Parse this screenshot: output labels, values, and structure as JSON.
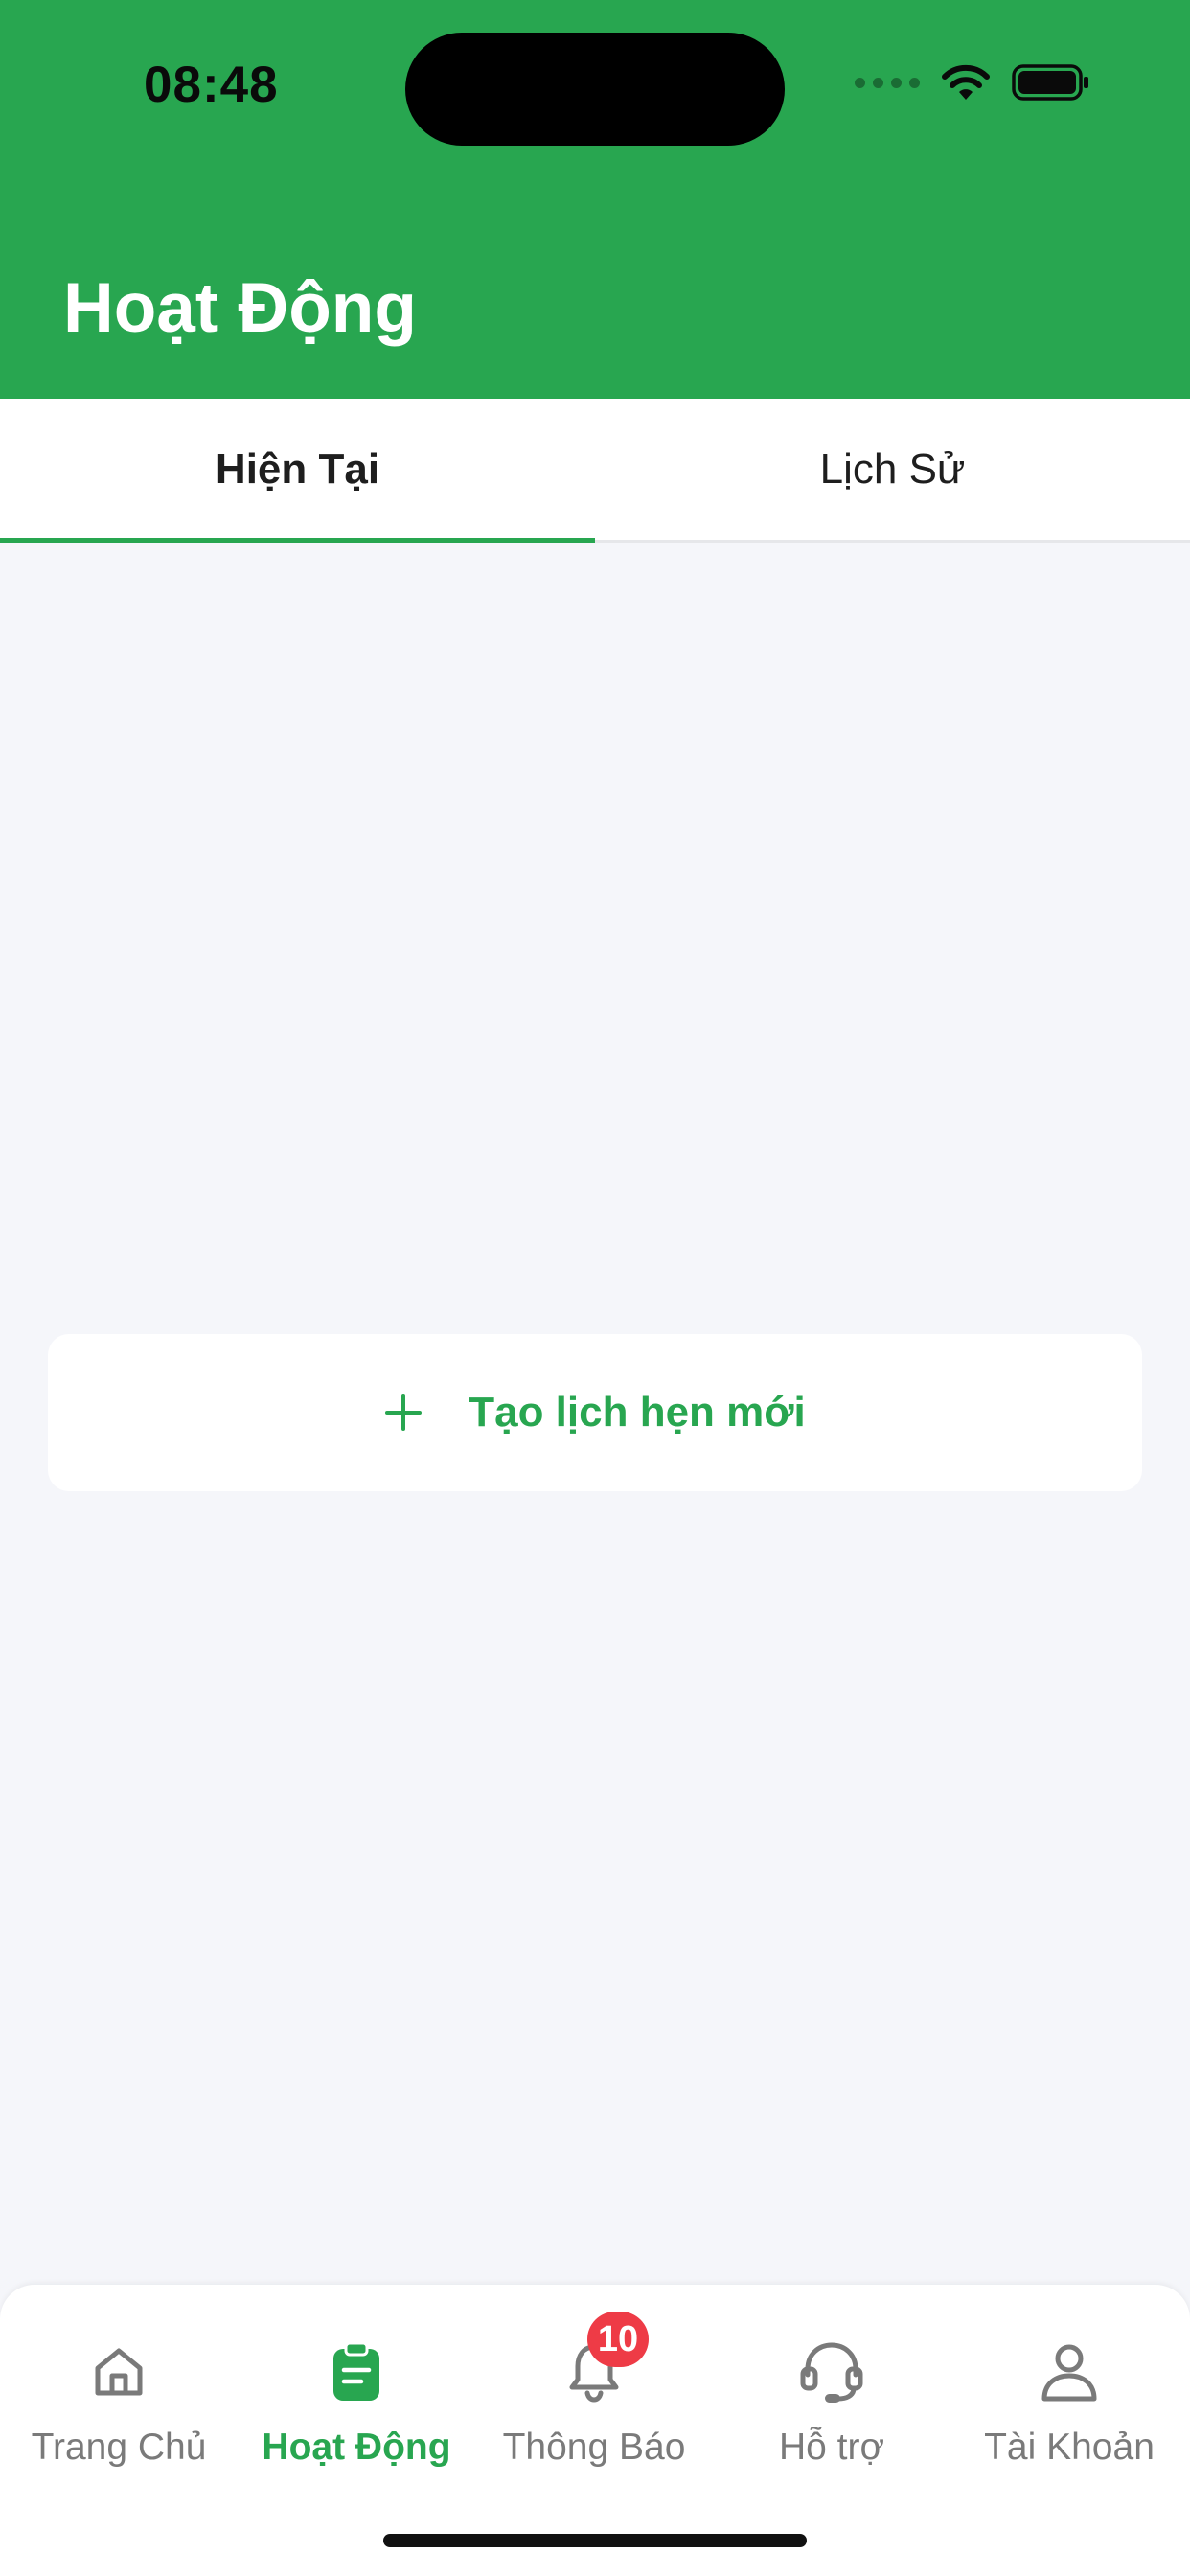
{
  "status_bar": {
    "time": "08:48",
    "icons": [
      "signal-dots-icon",
      "wifi-icon",
      "battery-icon"
    ]
  },
  "header": {
    "title": "Hoạt Động",
    "background_color": "#28a650"
  },
  "tabs": [
    {
      "label": "Hiện Tại",
      "active": true
    },
    {
      "label": "Lịch Sử",
      "active": false
    }
  ],
  "main": {
    "create_button": {
      "icon": "plus-icon",
      "label": "Tạo lịch hẹn mới"
    }
  },
  "bottom_nav": {
    "items": [
      {
        "label": "Trang Chủ",
        "icon": "home-icon",
        "active": false
      },
      {
        "label": "Hoạt Động",
        "icon": "clipboard-icon",
        "active": true
      },
      {
        "label": "Thông Báo",
        "icon": "bell-icon",
        "active": false,
        "badge": "10"
      },
      {
        "label": "Hỗ trợ",
        "icon": "headset-icon",
        "active": false
      },
      {
        "label": "Tài Khoản",
        "icon": "user-icon",
        "active": false
      }
    ]
  },
  "colors": {
    "accent": "#28a650",
    "badge": "#ee3b46",
    "inactive_text": "#7a7a7a",
    "background": "#f5f6fa"
  }
}
